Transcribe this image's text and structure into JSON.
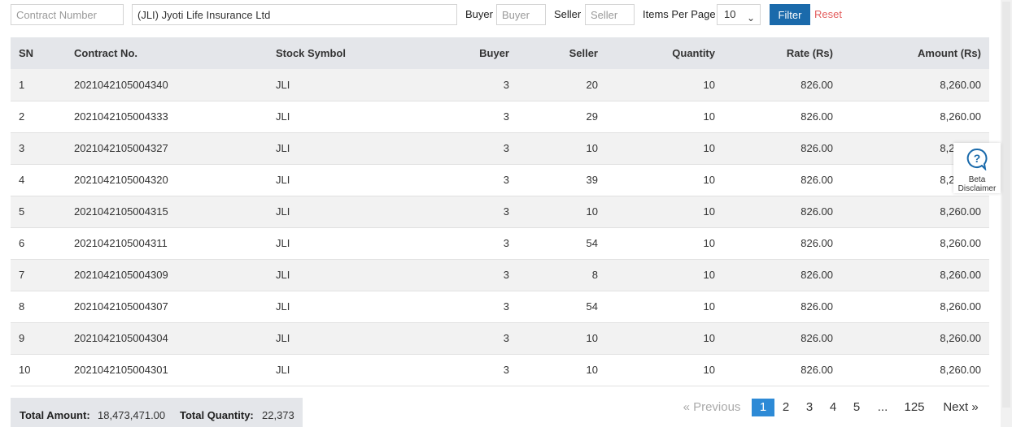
{
  "filters": {
    "contract_placeholder": "Contract Number",
    "company_value": "(JLI) Jyoti Life Insurance Ltd",
    "buyer_label": "Buyer",
    "buyer_placeholder": "Buyer",
    "seller_label": "Seller",
    "seller_placeholder": "Seller",
    "items_per_page_label": "Items Per Page",
    "items_per_page_value": "10",
    "filter_label": "Filter",
    "reset_label": "Reset"
  },
  "table": {
    "headers": {
      "sn": "SN",
      "contract": "Contract No.",
      "symbol": "Stock Symbol",
      "buyer": "Buyer",
      "seller": "Seller",
      "quantity": "Quantity",
      "rate": "Rate (Rs)",
      "amount": "Amount (Rs)"
    },
    "rows": [
      {
        "sn": "1",
        "contract": "2021042105004340",
        "symbol": "JLI",
        "buyer": "3",
        "seller": "20",
        "quantity": "10",
        "rate": "826.00",
        "amount": "8,260.00"
      },
      {
        "sn": "2",
        "contract": "2021042105004333",
        "symbol": "JLI",
        "buyer": "3",
        "seller": "29",
        "quantity": "10",
        "rate": "826.00",
        "amount": "8,260.00"
      },
      {
        "sn": "3",
        "contract": "2021042105004327",
        "symbol": "JLI",
        "buyer": "3",
        "seller": "10",
        "quantity": "10",
        "rate": "826.00",
        "amount": "8,260.00"
      },
      {
        "sn": "4",
        "contract": "2021042105004320",
        "symbol": "JLI",
        "buyer": "3",
        "seller": "39",
        "quantity": "10",
        "rate": "826.00",
        "amount": "8,260.00"
      },
      {
        "sn": "5",
        "contract": "2021042105004315",
        "symbol": "JLI",
        "buyer": "3",
        "seller": "10",
        "quantity": "10",
        "rate": "826.00",
        "amount": "8,260.00"
      },
      {
        "sn": "6",
        "contract": "2021042105004311",
        "symbol": "JLI",
        "buyer": "3",
        "seller": "54",
        "quantity": "10",
        "rate": "826.00",
        "amount": "8,260.00"
      },
      {
        "sn": "7",
        "contract": "2021042105004309",
        "symbol": "JLI",
        "buyer": "3",
        "seller": "8",
        "quantity": "10",
        "rate": "826.00",
        "amount": "8,260.00"
      },
      {
        "sn": "8",
        "contract": "2021042105004307",
        "symbol": "JLI",
        "buyer": "3",
        "seller": "54",
        "quantity": "10",
        "rate": "826.00",
        "amount": "8,260.00"
      },
      {
        "sn": "9",
        "contract": "2021042105004304",
        "symbol": "JLI",
        "buyer": "3",
        "seller": "10",
        "quantity": "10",
        "rate": "826.00",
        "amount": "8,260.00"
      },
      {
        "sn": "10",
        "contract": "2021042105004301",
        "symbol": "JLI",
        "buyer": "3",
        "seller": "10",
        "quantity": "10",
        "rate": "826.00",
        "amount": "8,260.00"
      }
    ]
  },
  "totals": {
    "amount_label": "Total Amount:",
    "amount_value": "18,473,471.00",
    "quantity_label": "Total Quantity:",
    "quantity_value": "22,373"
  },
  "pagination": {
    "previous": "« Previous",
    "pages": [
      "1",
      "2",
      "3",
      "4",
      "5",
      "...",
      "125"
    ],
    "active_page": "1",
    "next": "Next »"
  },
  "beta": {
    "icon": "question-bubble-icon",
    "line1": "Beta",
    "line2": "Disclaimer"
  },
  "colors": {
    "primary": "#1a6aab",
    "reset": "#e35d5d",
    "active_page": "#2d8ad6",
    "header_bg": "#e4e6ea",
    "stripe_bg": "#f2f2f2"
  }
}
